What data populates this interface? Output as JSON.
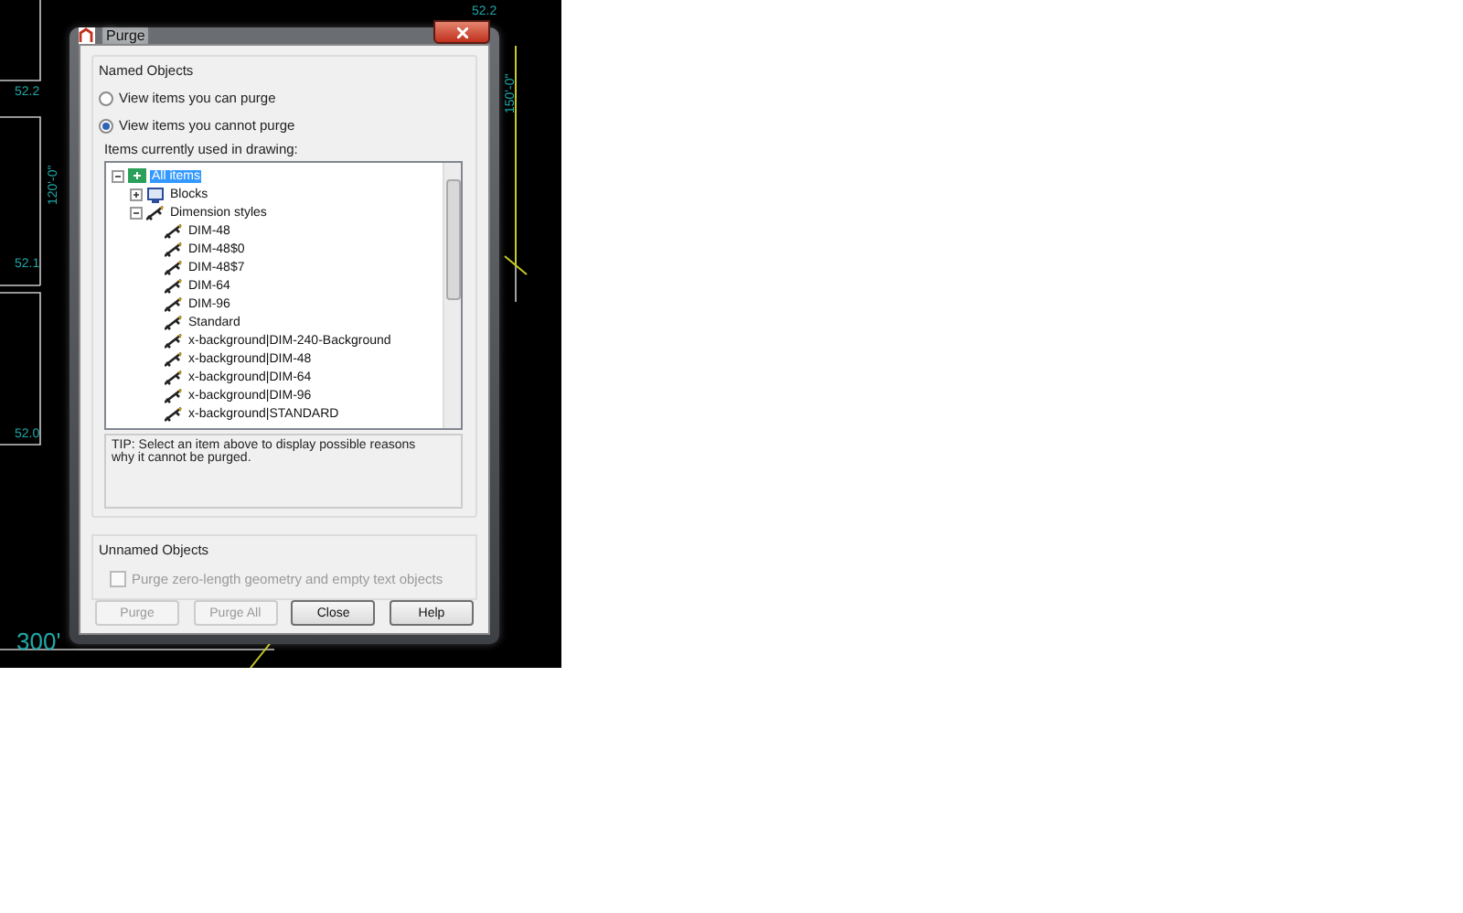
{
  "drawing_labels": [
    {
      "text": "52.2",
      "vertical": false
    },
    {
      "text": "52.2",
      "vertical": false
    },
    {
      "text": "120'-0\"",
      "vertical": true
    },
    {
      "text": "150'-0\"",
      "vertical": true
    },
    {
      "text": "52.1",
      "vertical": false
    },
    {
      "text": "52.0",
      "vertical": false
    },
    {
      "text": "300'",
      "vertical": false
    }
  ],
  "window": {
    "title": "Purge"
  },
  "named_objects": {
    "title": "Named Objects",
    "options": [
      {
        "label": "View items you can purge",
        "selected": false
      },
      {
        "label": "View items you cannot purge",
        "selected": true
      }
    ],
    "tree_label": "Items currently used in drawing:",
    "tree": [
      {
        "label": "All items",
        "kind": "all",
        "selected": true,
        "expanded": true,
        "children": [
          {
            "label": "Blocks",
            "kind": "blocks",
            "selected": false,
            "expanded": false
          },
          {
            "label": "Dimension styles",
            "kind": "dimstyle",
            "selected": false,
            "expanded": true,
            "children": [
              {
                "label": "DIM-48",
                "kind": "dimstyle",
                "selected": false
              },
              {
                "label": "DIM-48$0",
                "kind": "dimstyle",
                "selected": false
              },
              {
                "label": "DIM-48$7",
                "kind": "dimstyle",
                "selected": false
              },
              {
                "label": "DIM-64",
                "kind": "dimstyle",
                "selected": false
              },
              {
                "label": "DIM-96",
                "kind": "dimstyle",
                "selected": false
              },
              {
                "label": "Standard",
                "kind": "dimstyle",
                "selected": false
              },
              {
                "label": "x-background|DIM-240-Background",
                "kind": "dimstyle",
                "selected": false
              },
              {
                "label": "x-background|DIM-48",
                "kind": "dimstyle",
                "selected": false
              },
              {
                "label": "x-background|DIM-64",
                "kind": "dimstyle",
                "selected": false
              },
              {
                "label": "x-background|DIM-96",
                "kind": "dimstyle",
                "selected": false
              },
              {
                "label": "x-background|STANDARD",
                "kind": "dimstyle",
                "selected": false
              }
            ]
          }
        ]
      }
    ],
    "tip": "TIP: Select an item above to display possible reasons why it cannot be purged."
  },
  "unnamed_objects": {
    "title": "Unnamed Objects",
    "option": {
      "label": "Purge zero-length geometry and empty text objects",
      "checked": false,
      "disabled": true
    }
  },
  "buttons": [
    {
      "label": "Purge",
      "disabled": true
    },
    {
      "label": "Purge All",
      "disabled": true
    },
    {
      "label": "Close",
      "disabled": false
    },
    {
      "label": "Help",
      "disabled": false
    }
  ]
}
